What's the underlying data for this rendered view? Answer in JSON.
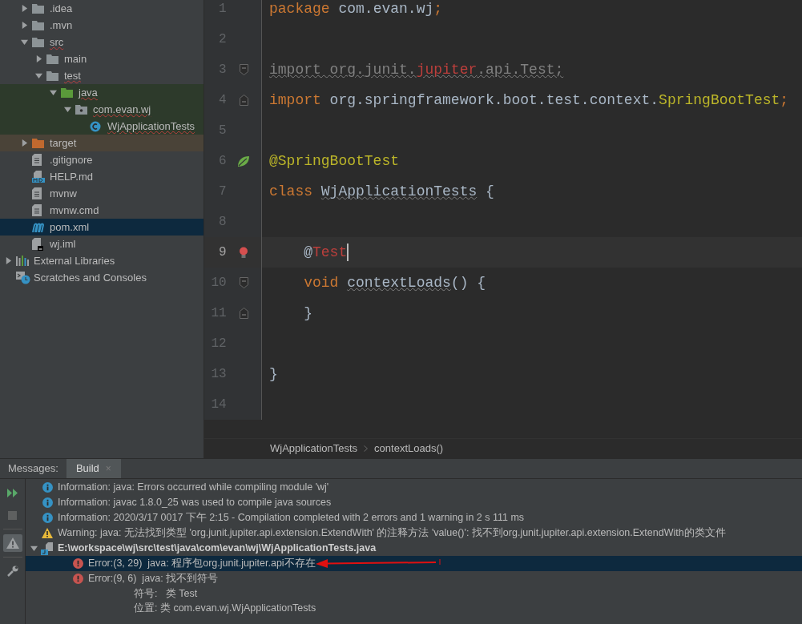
{
  "project_items": [
    {
      "label": ".idea",
      "kind": "folder",
      "expanded": false,
      "selected": false,
      "misspelled": false
    },
    {
      "label": ".mvn",
      "kind": "folder",
      "expanded": false,
      "selected": false,
      "misspelled": false
    },
    {
      "label": "src",
      "kind": "folder",
      "expanded": true,
      "selected": false,
      "misspelled": true,
      "children": [
        {
          "label": "main",
          "kind": "folder",
          "expanded": false,
          "selected": false,
          "misspelled": false
        },
        {
          "label": "test",
          "kind": "folder",
          "expanded": true,
          "selected": false,
          "misspelled": true,
          "children": [
            {
              "label": "java",
              "kind": "test_root",
              "test_source": true,
              "expanded": true,
              "selected": false,
              "misspelled": true,
              "children": [
                {
                  "label": "com.evan.wj",
                  "kind": "package",
                  "test_source": true,
                  "expanded": true,
                  "selected": false,
                  "misspelled": true,
                  "children": [
                    {
                      "label": "WjApplicationTests",
                      "kind": "class",
                      "test_source": true,
                      "selected": false,
                      "misspelled": true
                    }
                  ]
                }
              ]
            }
          ]
        }
      ]
    },
    {
      "label": "target",
      "kind": "folder",
      "excluded": true,
      "expanded": false,
      "selected": false,
      "misspelled": false
    },
    {
      "label": ".gitignore",
      "kind": "text_file",
      "selected": false,
      "misspelled": false
    },
    {
      "label": "HELP.md",
      "kind": "markdown",
      "selected": false,
      "misspelled": false
    },
    {
      "label": "mvnw",
      "kind": "text_file",
      "selected": false,
      "misspelled": false
    },
    {
      "label": "mvnw.cmd",
      "kind": "text_file",
      "selected": false,
      "misspelled": false
    },
    {
      "label": "pom.xml",
      "kind": "maven",
      "selected": true,
      "misspelled": false
    },
    {
      "label": "wj.iml",
      "kind": "module_file",
      "selected": false,
      "misspelled": false
    }
  ],
  "root_items": [
    {
      "label": "External Libraries",
      "kind": "libraries",
      "expanded": false,
      "selected": false
    },
    {
      "label": "Scratches and Consoles",
      "kind": "scratches",
      "selected": false
    }
  ],
  "editor": {
    "lines": [
      {
        "number": "1",
        "current": false,
        "tokens": [
          {
            "text": "package",
            "kind": "keyword"
          },
          {
            "text": " com.evan.wj",
            "kind": "plain"
          },
          {
            "text": ";",
            "kind": "keyword"
          }
        ]
      },
      {
        "number": "2",
        "current": false
      },
      {
        "number": "3",
        "current": false,
        "marker": {
          "kind": "fold_start"
        },
        "weak_warning": true,
        "tokens": [
          {
            "text": "import org.junit.",
            "kind": "unused"
          },
          {
            "text": "jupiter",
            "kind": "unresolved"
          },
          {
            "text": ".api.Test;",
            "kind": "unused"
          }
        ]
      },
      {
        "number": "4",
        "current": false,
        "marker": {
          "kind": "fold_end"
        },
        "tokens": [
          {
            "text": "import",
            "kind": "keyword"
          },
          {
            "text": " org.springframework.boot.test.context.",
            "kind": "plain"
          },
          {
            "text": "SpringBootTest",
            "kind": "annotation"
          },
          {
            "text": ";",
            "kind": "keyword"
          }
        ]
      },
      {
        "number": "5",
        "current": false
      },
      {
        "number": "6",
        "current": false,
        "marker": {
          "kind": "spring"
        },
        "tokens": [
          {
            "text": "@SpringBootTest",
            "kind": "annotation"
          }
        ]
      },
      {
        "number": "7",
        "current": false,
        "tokens": [
          {
            "text": "class ",
            "kind": "keyword"
          },
          {
            "text": "WjApplicationTests",
            "kind": "typo"
          },
          {
            "text": " {",
            "kind": "plain"
          }
        ]
      },
      {
        "number": "8",
        "current": false
      },
      {
        "number": "9",
        "current": true,
        "marker": {
          "kind": "bulb"
        },
        "tokens": [
          {
            "text": "    @",
            "kind": "plain"
          },
          {
            "text": "Test",
            "kind": "unresolved"
          }
        ]
      },
      {
        "number": "10",
        "current": false,
        "marker": {
          "kind": "fold_start"
        },
        "tokens": [
          {
            "text": "    void ",
            "kind": "keyword"
          },
          {
            "text": "contextLoads",
            "kind": "typo"
          },
          {
            "text": "() {",
            "kind": "plain"
          }
        ]
      },
      {
        "number": "11",
        "current": false,
        "marker": {
          "kind": "fold_end"
        },
        "tokens": [
          {
            "text": "    }",
            "kind": "plain"
          }
        ]
      },
      {
        "number": "12",
        "current": false
      },
      {
        "number": "13",
        "current": false,
        "tokens": [
          {
            "text": "}",
            "kind": "plain"
          }
        ]
      },
      {
        "number": "14",
        "current": false
      }
    ]
  },
  "breadcrumbs": [
    "WjApplicationTests",
    "contextLoads()"
  ],
  "bottom_panel": {
    "label": "Messages:",
    "tabs": [
      {
        "label": "Build",
        "selected": true,
        "close": "×"
      }
    ],
    "toolbar": [
      {
        "kind": "rerun",
        "selected": false,
        "disabled": false
      },
      {
        "kind": "stop",
        "selected": false,
        "disabled": true
      },
      {
        "kind": "warnings",
        "selected": true,
        "disabled": false
      },
      {
        "kind": "settings",
        "selected": false,
        "disabled": false
      }
    ],
    "messages": [
      {
        "kind": "info",
        "text": "Information: java: Errors occurred while compiling module 'wj'",
        "selected": false
      },
      {
        "kind": "info",
        "text": "Information: javac 1.8.0_25 was used to compile java sources",
        "selected": false
      },
      {
        "kind": "info",
        "text": "Information: 2020/3/17 0017 下午 2:15 - Compilation completed with 2 errors and 1 warning in 2 s 111 ms",
        "selected": false
      },
      {
        "kind": "warning",
        "text": "Warning: java: 无法找到类型 'org.junit.jupiter.api.extension.ExtendWith' 的注释方法 'value()': 找不到org.junit.jupiter.api.extension.ExtendWith的类文件",
        "selected": false
      },
      {
        "kind": "file",
        "text": "E:\\workspace\\wj\\src\\test\\java\\com\\evan\\wj\\WjApplicationTests.java",
        "expanded": true,
        "selected": false,
        "children": [
          {
            "kind": "error",
            "text": "Error:(3, 29)  java: 程序包org.junit.jupiter.api不存在",
            "selected": true
          },
          {
            "kind": "error",
            "text": "Error:(9, 6)  java: 找不到符号",
            "selected": false,
            "details": [
              "符号:   类 Test",
              "位置: 类 com.evan.wj.WjApplicationTests"
            ]
          }
        ]
      }
    ]
  }
}
